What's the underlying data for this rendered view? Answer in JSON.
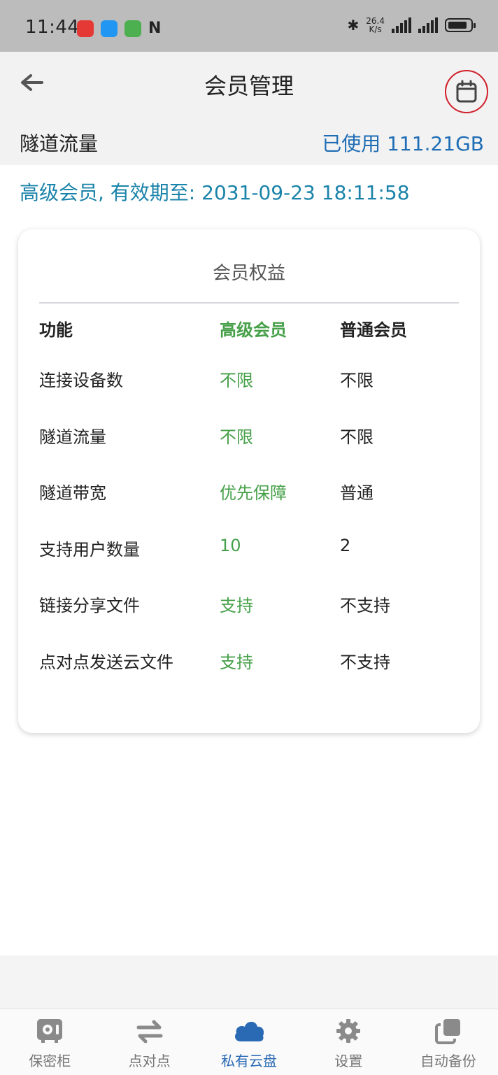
{
  "status_bar": {
    "time": "11:44",
    "net_speed_value": "26.4",
    "net_speed_unit": "K/s"
  },
  "header": {
    "title": "会员管理",
    "traffic_label": "隧道流量",
    "traffic_value": "已使用 111.21GB"
  },
  "membership": {
    "status_text": "高级会员, 有效期至: 2031-09-23 18:11:58"
  },
  "benefits": {
    "title": "会员权益",
    "columns": [
      "功能",
      "高级会员",
      "普通会员"
    ],
    "rows": [
      [
        "连接设备数",
        "不限",
        "不限"
      ],
      [
        "隧道流量",
        "不限",
        "不限"
      ],
      [
        "隧道带宽",
        "优先保障",
        "普通"
      ],
      [
        "支持用户数量",
        "10",
        "2"
      ],
      [
        "链接分享文件",
        "支持",
        "不支持"
      ],
      [
        "点对点发送云文件",
        "支持",
        "不支持"
      ]
    ]
  },
  "bottom_nav": {
    "items": [
      {
        "label": "保密柜",
        "icon": "safe-icon"
      },
      {
        "label": "点对点",
        "icon": "swap-arrows-icon"
      },
      {
        "label": "私有云盘",
        "icon": "cloud-icon"
      },
      {
        "label": "设置",
        "icon": "gear-icon"
      },
      {
        "label": "自动备份",
        "icon": "copy-icon"
      }
    ],
    "active_index": 2
  },
  "colors": {
    "accent_blue": "#1f6db5",
    "status_teal": "#1a83a9",
    "premium_green": "#46a049",
    "highlight_red": "#d0202a"
  }
}
